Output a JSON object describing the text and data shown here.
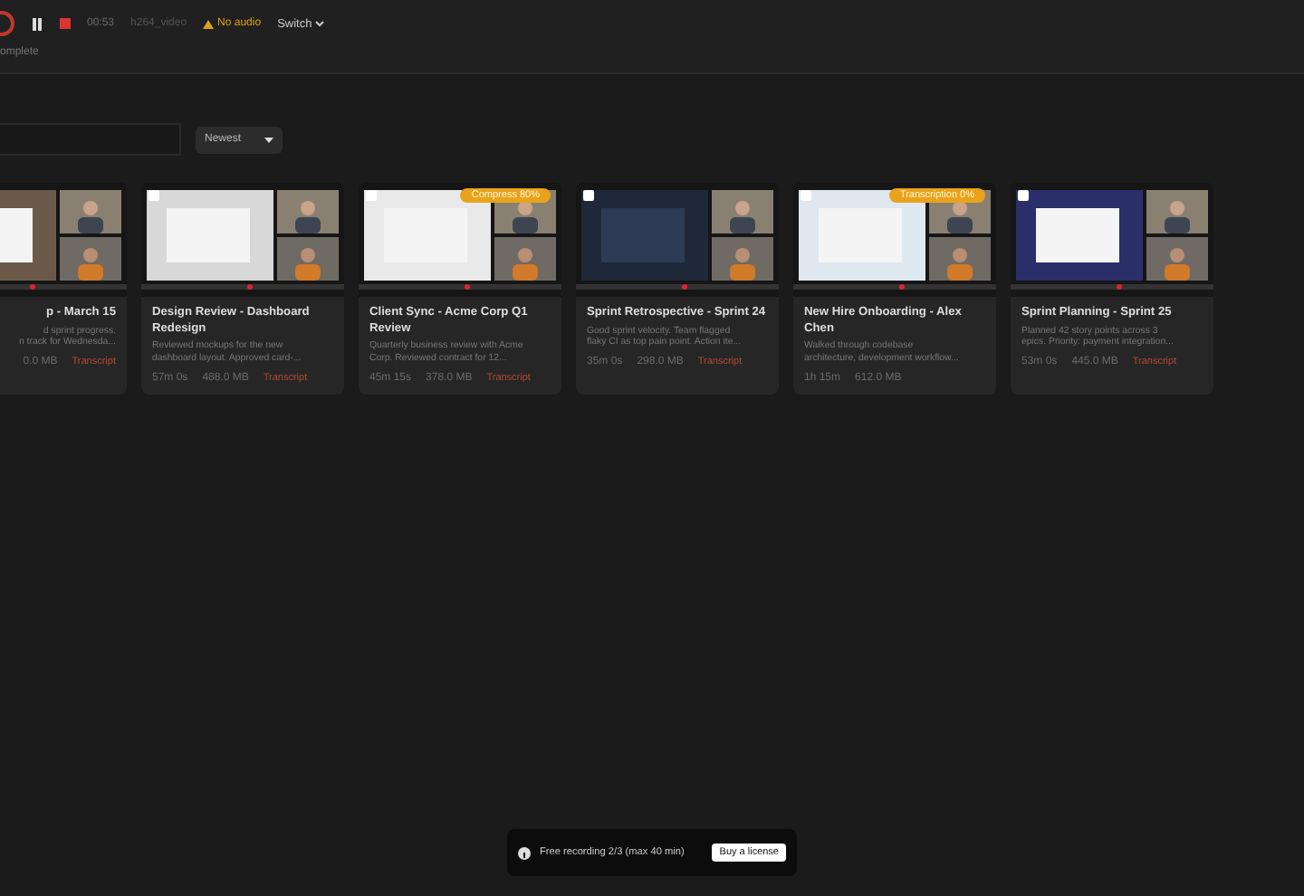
{
  "toolbar": {
    "recording": true,
    "paused": false,
    "time": "00:53",
    "codec": "h264_video",
    "audio_warning": "No audio",
    "switch": "Switch",
    "status": "omplete"
  },
  "sort": {
    "value": "Newest"
  },
  "cards": [
    {
      "title": "p - March 15",
      "desc_lines": [
        "d sprint progress.",
        "n track for Wednesda..."
      ],
      "size": "0.0 MB",
      "transcript": "Transcript"
    },
    {
      "title": "Design Review - Dashboard Redesign",
      "desc_lines": [
        "Reviewed mockups for the new",
        "dashboard layout. Approved card-..."
      ],
      "duration": "57m 0s",
      "size": "488.0 MB",
      "transcript": "Transcript",
      "checked": false
    },
    {
      "title": "Client Sync - Acme Corp Q1 Review",
      "desc_lines": [
        "Quarterly business review with Acme",
        "Corp. Reviewed contract for 12..."
      ],
      "duration": "45m 15s",
      "size": "378.0 MB",
      "transcript": "Transcript",
      "checked": false,
      "badge": "Compress 80%"
    },
    {
      "title": "Sprint Retrospective - Sprint 24",
      "desc_lines": [
        "Good sprint velocity. Team flagged",
        "flaky CI as top pain point. Action ite..."
      ],
      "duration": "35m 0s",
      "size": "298.0 MB",
      "transcript": "Transcript",
      "checked": false
    },
    {
      "title": "New Hire Onboarding - Alex Chen",
      "desc_lines": [
        "Walked through codebase",
        "architecture, development workflow..."
      ],
      "duration": "1h 15m",
      "size": "612.0 MB",
      "checked": false,
      "badge": "Transcription 0%"
    },
    {
      "title": "Sprint Planning - Sprint 25",
      "desc_lines": [
        "Planned 42 story points across 3",
        "epics. Priority: payment integration..."
      ],
      "duration": "53m 0s",
      "size": "445.0 MB",
      "transcript": "Transcript",
      "checked": false
    }
  ],
  "toast": {
    "message": "Free recording 2/3 (max 40 min)",
    "button": "Buy a license"
  }
}
